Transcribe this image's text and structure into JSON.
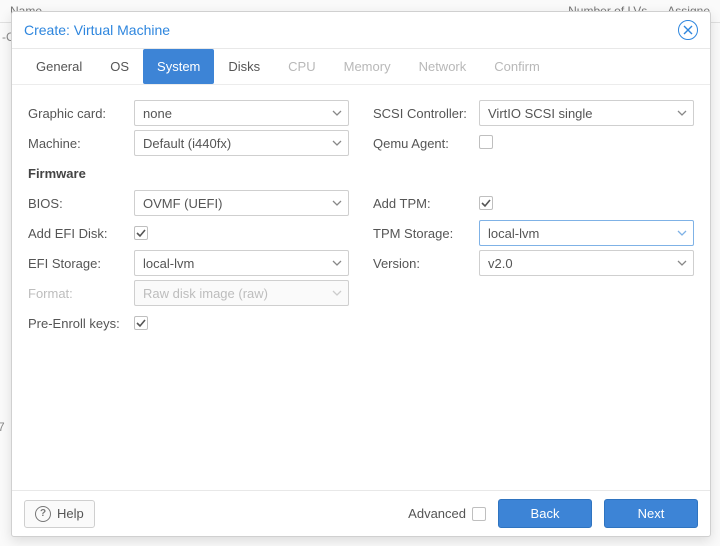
{
  "background": {
    "cnx": "-CNX)",
    "name_col": "Name",
    "lvs_col": "Number of LVs",
    "assign_col": "Assigne",
    "row_num": "7"
  },
  "dialog": {
    "title": "Create: Virtual Machine"
  },
  "tabs": {
    "general": "General",
    "os": "OS",
    "system": "System",
    "disks": "Disks",
    "cpu": "CPU",
    "memory": "Memory",
    "network": "Network",
    "confirm": "Confirm"
  },
  "left": {
    "graphic_card_label": "Graphic card:",
    "graphic_card_value": "none",
    "machine_label": "Machine:",
    "machine_value": "Default (i440fx)",
    "firmware_label": "Firmware",
    "bios_label": "BIOS:",
    "bios_value": "OVMF (UEFI)",
    "add_efi_label": "Add EFI Disk:",
    "efi_storage_label": "EFI Storage:",
    "efi_storage_value": "local-lvm",
    "format_label": "Format:",
    "format_value": "Raw disk image (raw)",
    "pre_enroll_label": "Pre-Enroll keys:"
  },
  "right": {
    "scsi_label": "SCSI Controller:",
    "scsi_value": "VirtIO SCSI single",
    "qemu_label": "Qemu Agent:",
    "add_tpm_label": "Add TPM:",
    "tpm_storage_label": "TPM Storage:",
    "tpm_storage_value": "local-lvm",
    "version_label": "Version:",
    "version_value": "v2.0"
  },
  "footer": {
    "help": "Help",
    "advanced": "Advanced",
    "back": "Back",
    "next": "Next"
  }
}
